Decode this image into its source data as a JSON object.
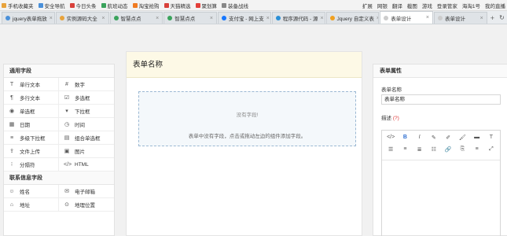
{
  "browser": {
    "bookmarks": [
      {
        "label": "手机收藏夹",
        "color": "#e8a33c"
      },
      {
        "label": "安全导航",
        "color": "#4a90d9"
      },
      {
        "label": "今日头条",
        "color": "#d8403a"
      },
      {
        "label": "航班动态",
        "color": "#3aa35c"
      },
      {
        "label": "淘宝抢购",
        "color": "#f07b22"
      },
      {
        "label": "天猫精选",
        "color": "#d8403a"
      },
      {
        "label": "聚划算",
        "color": "#e33f3a"
      },
      {
        "label": "装备战线",
        "color": "#888888"
      }
    ],
    "bookmarks_right": [
      "扩展",
      "网银",
      "翻译",
      "截图",
      "游戏",
      "登录管家",
      "海淘1号",
      "我的直播"
    ],
    "tabs": [
      {
        "label": "jquery表单拖放",
        "color": "#4a90d9",
        "active": false
      },
      {
        "label": "实例源码大全",
        "color": "#e8a33c",
        "active": false
      },
      {
        "label": "智慧点点",
        "color": "#3aa35c",
        "active": false
      },
      {
        "label": "智慧点点",
        "color": "#3aa35c",
        "active": false
      },
      {
        "label": "支付宝 - 网上支",
        "color": "#1677ff",
        "active": false
      },
      {
        "label": "程序源代码 - 源",
        "color": "#2a8fd6",
        "active": false
      },
      {
        "label": "Jquery 自定义表",
        "color": "#f0a020",
        "active": false
      },
      {
        "label": "表单设计",
        "color": "#cccccc",
        "active": true
      },
      {
        "label": "表单设计",
        "color": "#cccccc",
        "active": false
      }
    ],
    "tab_add": "+",
    "tab_menu": "↻"
  },
  "left_panel": {
    "common_title": "通用字段",
    "common_fields": [
      {
        "icon": "T",
        "label": "单行文本",
        "name": "single-line-text"
      },
      {
        "icon": "#",
        "label": "数字",
        "name": "number"
      },
      {
        "icon": "¶",
        "label": "多行文本",
        "name": "multi-line-text"
      },
      {
        "icon": "☑",
        "label": "多选框",
        "name": "checkbox"
      },
      {
        "icon": "◉",
        "label": "单选框",
        "name": "radio"
      },
      {
        "icon": "▾",
        "label": "下拉框",
        "name": "dropdown"
      },
      {
        "icon": "▦",
        "label": "日期",
        "name": "date"
      },
      {
        "icon": "◷",
        "label": "时间",
        "name": "time"
      },
      {
        "icon": "≡",
        "label": "多级下拉框",
        "name": "cascade-dropdown"
      },
      {
        "icon": "▤",
        "label": "组合单选框",
        "name": "radio-group"
      },
      {
        "icon": "⇪",
        "label": "文件上传",
        "name": "file-upload"
      },
      {
        "icon": "▣",
        "label": "图片",
        "name": "image"
      },
      {
        "icon": "⁝",
        "label": "分隔符",
        "name": "separator"
      },
      {
        "icon": "</>",
        "label": "HTML",
        "name": "html"
      }
    ],
    "contact_title": "联系信息字段",
    "contact_fields": [
      {
        "icon": "☺",
        "label": "姓名",
        "name": "name"
      },
      {
        "icon": "✉",
        "label": "电子邮箱",
        "name": "email"
      },
      {
        "icon": "⌂",
        "label": "地址",
        "name": "address"
      },
      {
        "icon": "⊙",
        "label": "地理位置",
        "name": "location"
      }
    ]
  },
  "form": {
    "title": "表单名称",
    "empty_title": "没有字段!",
    "empty_hint": "表单中没有字段，点击或拖动左边的组件添加字段。"
  },
  "right_panel": {
    "title": "表单属性",
    "name_label": "表单名称",
    "name_value": "表单名称",
    "desc_label": "描述",
    "desc_help": "(?)",
    "toolbar": [
      {
        "glyph": "</>",
        "name": "code-view-icon"
      },
      {
        "glyph": "B",
        "name": "bold-icon"
      },
      {
        "glyph": "I",
        "name": "italic-icon"
      },
      {
        "glyph": "✎",
        "name": "strikethrough-icon"
      },
      {
        "glyph": "✐",
        "name": "highlight-icon"
      },
      {
        "glyph": "🖌",
        "name": "brush-icon"
      },
      {
        "glyph": "▬",
        "name": "color-icon"
      },
      {
        "glyph": "T",
        "name": "font-size-icon"
      },
      {
        "glyph": "☰",
        "name": "list-icon"
      },
      {
        "glyph": "≡",
        "name": "align-left-icon"
      },
      {
        "glyph": "≣",
        "name": "align-center-icon"
      },
      {
        "glyph": "☷",
        "name": "align-right-icon"
      },
      {
        "glyph": "🔗",
        "name": "link-icon"
      },
      {
        "glyph": "⎘",
        "name": "unlink-icon"
      },
      {
        "glyph": "≡",
        "name": "indent-icon"
      },
      {
        "glyph": "⤢",
        "name": "fullscreen-icon"
      }
    ]
  }
}
